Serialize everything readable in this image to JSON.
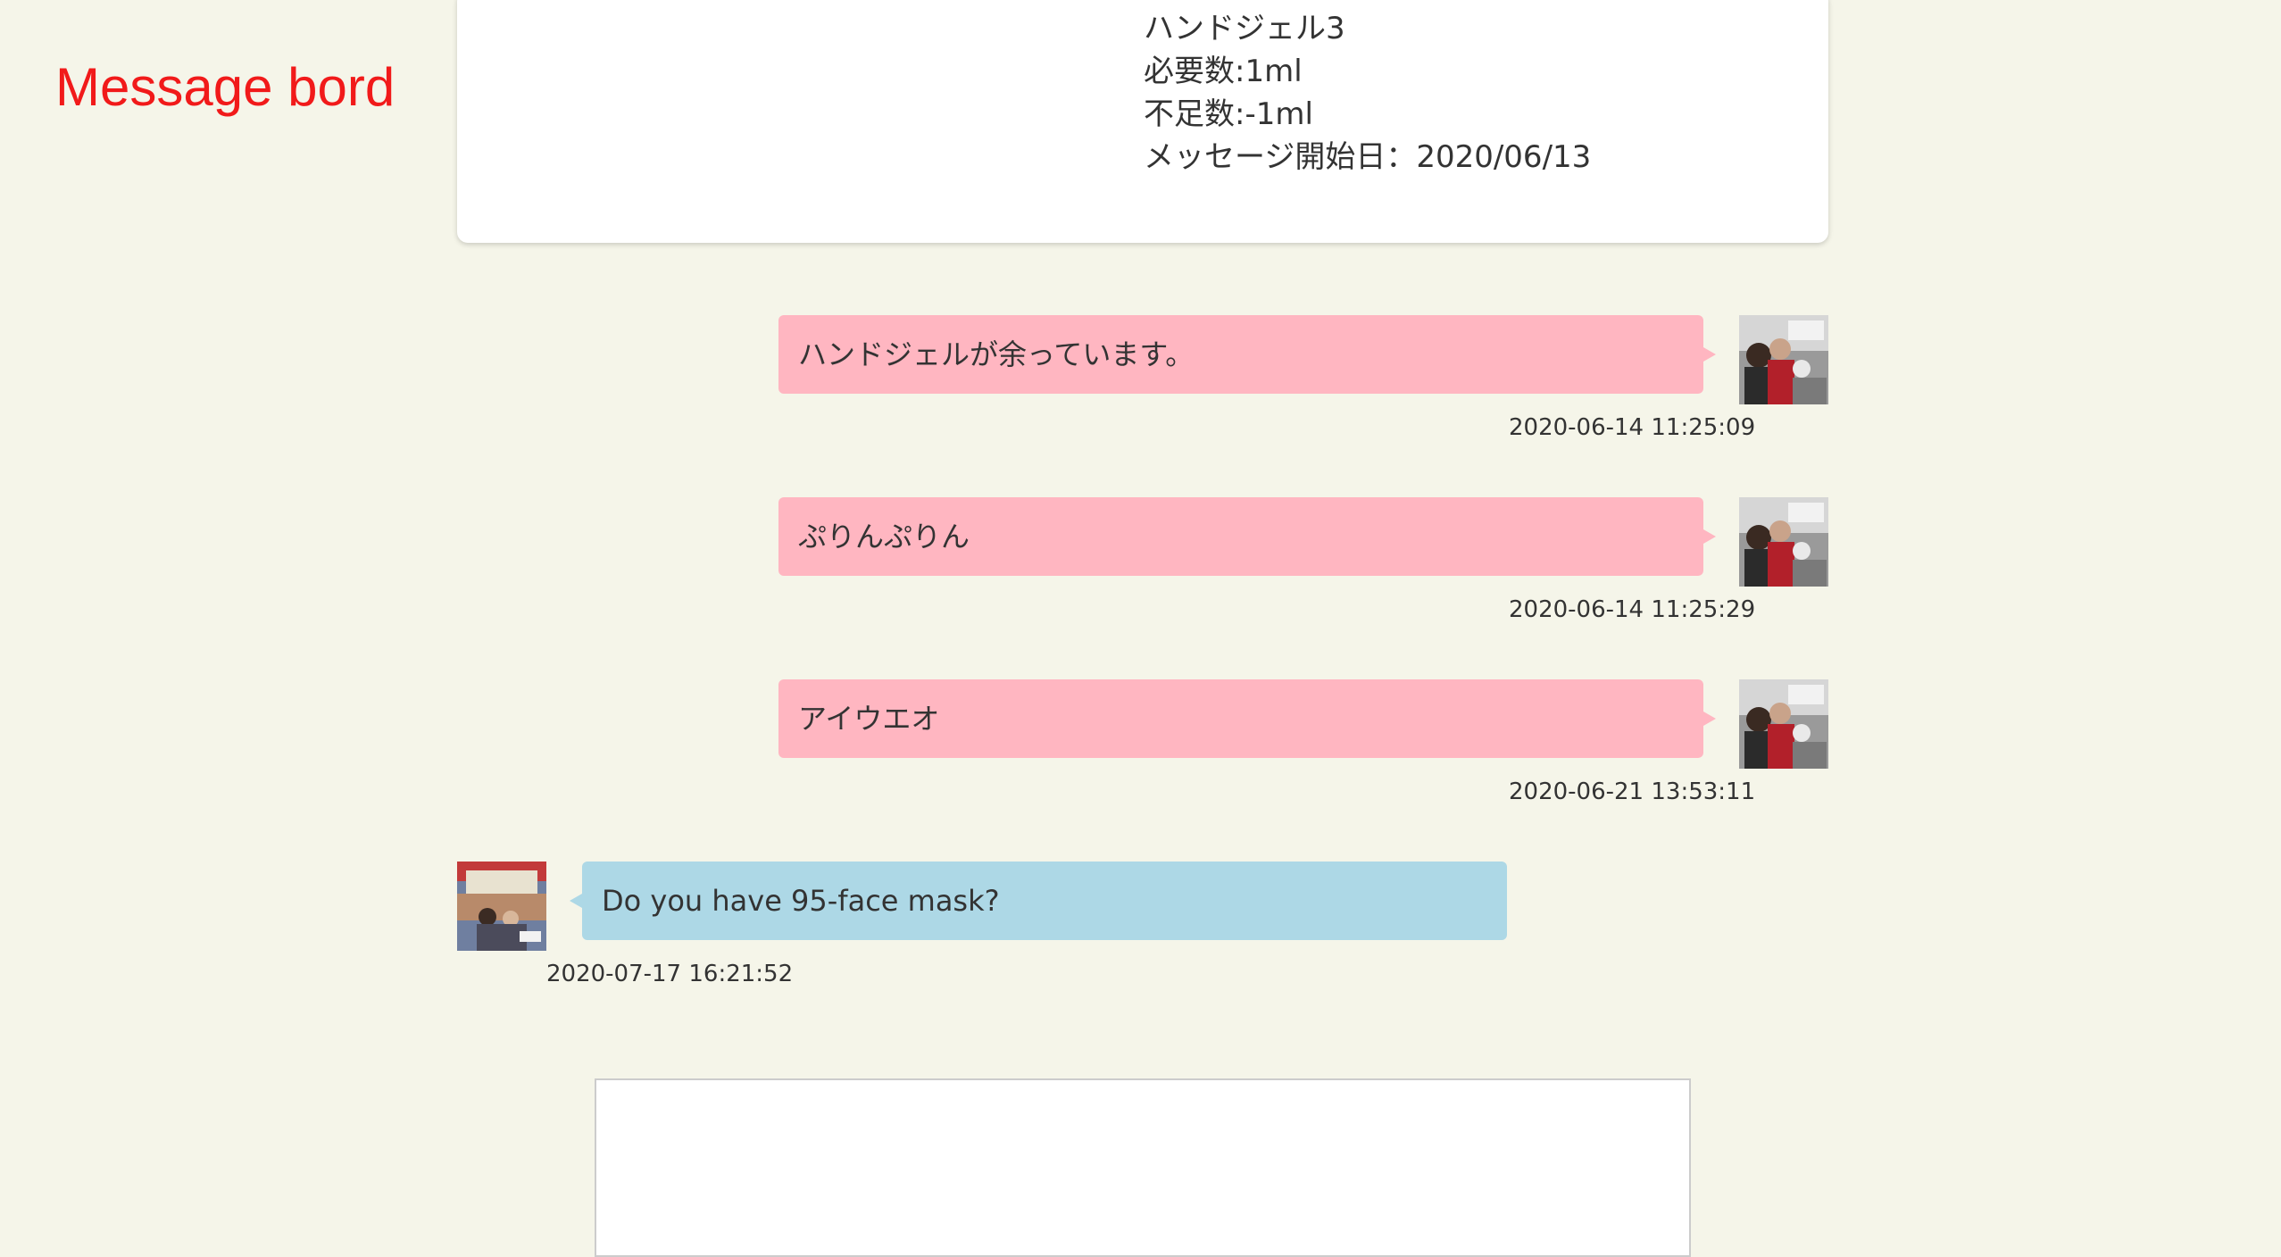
{
  "page": {
    "title": "Message bord"
  },
  "info": {
    "lines": [
      "ハンドジェル3",
      "必要数:1ml",
      "不足数:-1ml",
      "メッセージ開始日：2020/06/13"
    ]
  },
  "messages": [
    {
      "sender": "self",
      "text": "ハンドジェルが余っています。",
      "timestamp": "2020-06-14 11:25:09",
      "avatar": "user-photo-avatar"
    },
    {
      "sender": "self",
      "text": "ぷりんぷりん",
      "timestamp": "2020-06-14 11:25:29",
      "avatar": "user-photo-avatar"
    },
    {
      "sender": "self",
      "text": "アイウエオ",
      "timestamp": "2020-06-21 13:53:11",
      "avatar": "user-photo-avatar"
    },
    {
      "sender": "other",
      "text": "Do you have 95-face mask?",
      "timestamp": "2020-07-17 16:21:52",
      "avatar": "partner-photo-avatar"
    }
  ],
  "compose": {
    "value": "",
    "placeholder": ""
  },
  "colors": {
    "background": "#f5f5e9",
    "title": "#f11a1a",
    "self_bubble": "#ffb6c1",
    "other_bubble": "#add8e6",
    "card": "#ffffff"
  }
}
